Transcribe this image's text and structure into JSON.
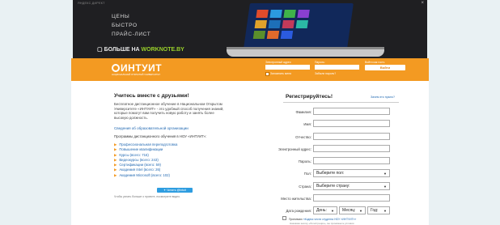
{
  "ad": {
    "label": "ЯНДЕКС.ДИРЕКТ",
    "line1": "ЦЕНЫ",
    "line2": "БЫСТРО",
    "line3": "ПРАЙС-ЛИСТ",
    "more_text": "БОЛЬШЕ НА",
    "more_link": "WORKNOTE.BY",
    "close": "×"
  },
  "header": {
    "logo": "ИНТУИТ",
    "logo_sub": "НАЦИОНАЛЬНЫЙ ОТКРЫТЫЙ УНИВЕРСИТЕТ",
    "email_label": "Электронный адрес:",
    "password_label": "Пароль:",
    "remember_label": "Запомнить меня",
    "forgot_label": "Забыли пароль?",
    "login_hint": "Войти как гость",
    "login_button": "Войти"
  },
  "left": {
    "title": "Учитесь вместе с друзьями!",
    "intro": "Бесплатное дистанционное обучение в Национальном Открытом Университете «ИНТУИТ» - это удобный способ получения знаний, которые помогут вам получить новую работу и занять более высокую должность.",
    "org_link": "Сведения об образовательной организации",
    "programs_label": "Программы дистанционного обучения в НОУ «ИНТУИТ»:",
    "programs": [
      "Профессиональная переподготовка",
      "Повышение квалификации",
      "Курсы (всего: 716)",
      "Видеокурсы (всего: 243)",
      "Сертификации (всего: 59)",
      "Академия Intel (всего: 26)",
      "Академия Microsoft (всего: 102)"
    ],
    "twitter_button": "Читать @intuit",
    "note": "Чтобы узнать больше о проекте, посмотрите видео."
  },
  "register": {
    "title": "Регистрируйтесь!",
    "link": "Зачем это нужно?",
    "fields": {
      "lastname": "Фамилия:",
      "firstname": "Имя:",
      "middlename": "Отчество:",
      "email": "Электронный адрес:",
      "password": "Пароль:",
      "gender": "Пол:",
      "country": "Страна:",
      "city": "Место жительства:",
      "birthdate": "Дата рождения:"
    },
    "gender_value": "Выберите пол:",
    "country_value": "Выберите страну:",
    "day": "День:",
    "month": "Месяц:",
    "year": "Год:",
    "agree_text": "Принимаю",
    "agree_link": "«Кодекс чести студента НОУ «ИНТУИТ»»",
    "agree_sub": "Нажимая кнопку «Регистрация», вы принимаете условия"
  }
}
